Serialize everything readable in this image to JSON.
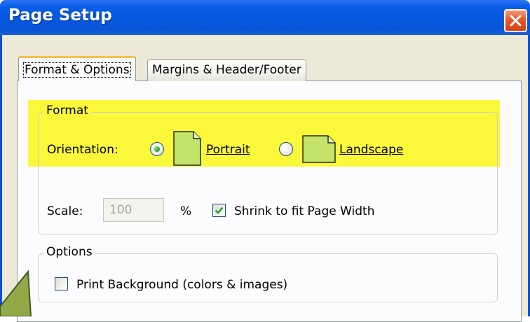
{
  "window": {
    "title": "Page Setup"
  },
  "tabs": [
    {
      "label": "Format & Options",
      "active": true
    },
    {
      "label": "Margins & Header/Footer",
      "active": false
    }
  ],
  "format": {
    "legend": "Format",
    "orientation_label": "Orientation:",
    "portrait_label": "Portrait",
    "landscape_label": "Landscape",
    "selected": "Portrait",
    "scale_label": "Scale:",
    "scale_value": "100",
    "percent_sign": "%",
    "shrink_label": "Shrink to fit Page Width",
    "shrink_checked": true
  },
  "options": {
    "legend": "Options",
    "print_background_label": "Print Background (colors & images)",
    "print_background_checked": false
  },
  "colors": {
    "titlebar": "#0556e0",
    "highlight": "#fbf83c",
    "page_icon": "#c3e36a",
    "close_button": "#e5582e"
  },
  "icons": [
    "close-icon",
    "portrait-page-icon",
    "landscape-page-icon",
    "checkmark-icon",
    "pointer-arrow-icon"
  ]
}
